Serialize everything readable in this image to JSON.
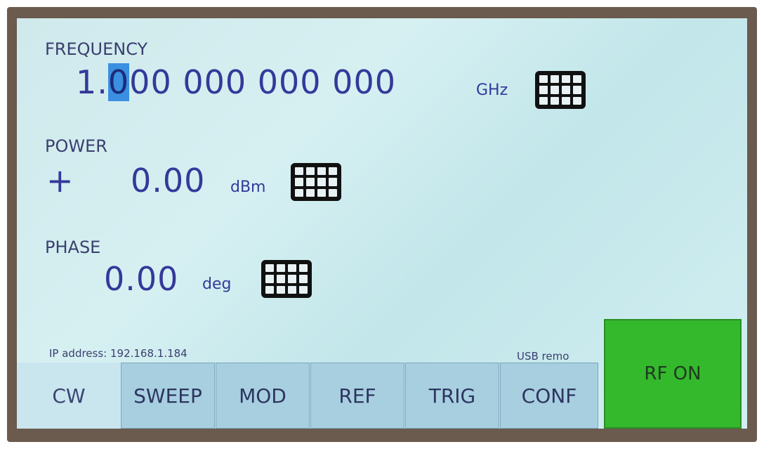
{
  "frequency": {
    "label": "FREQUENCY",
    "value_lead": "1.",
    "value_cursor": "0",
    "value_rest": "00 000 000 000",
    "unit": "GHz",
    "keypad_icon": "keypad-icon"
  },
  "power": {
    "label": "POWER",
    "sign": "+",
    "value": "0.00",
    "unit": "dBm",
    "keypad_icon": "keypad-icon"
  },
  "phase": {
    "label": "PHASE",
    "value": "0.00",
    "unit": "deg",
    "keypad_icon": "keypad-icon"
  },
  "status": {
    "ip": "IP address: 192.168.1.184",
    "remote": "USB remo"
  },
  "tabs": [
    {
      "label": "CW"
    },
    {
      "label": "SWEEP"
    },
    {
      "label": "MOD"
    },
    {
      "label": "REF"
    },
    {
      "label": "TRIG"
    },
    {
      "label": "CONF"
    }
  ],
  "rf_button": {
    "label": "RF ON",
    "color": "#34b82c"
  },
  "colors": {
    "screen": "#cfe9ec",
    "text": "#34399a",
    "cursor": "#3a8fe0"
  }
}
